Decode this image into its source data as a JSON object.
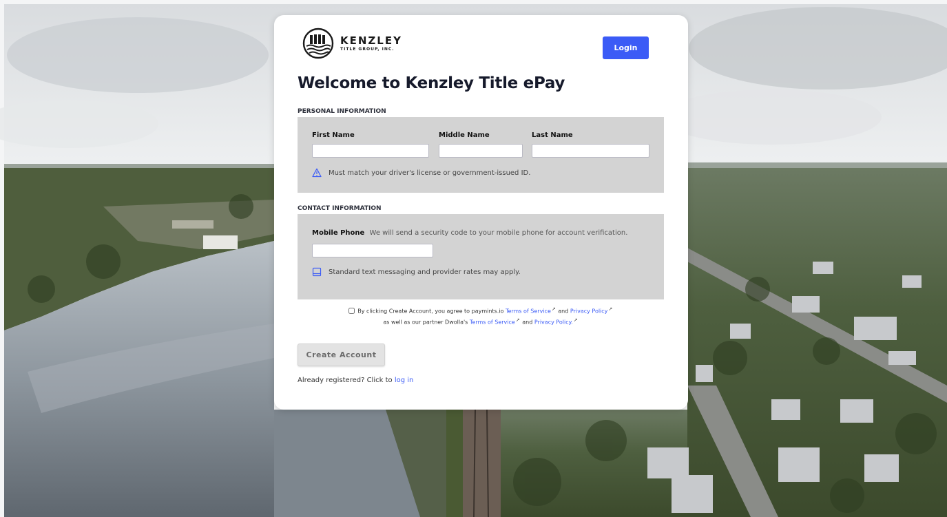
{
  "brand": {
    "name": "KENZLEY",
    "subtitle": "TITLE GROUP, INC."
  },
  "header": {
    "login_label": "Login"
  },
  "page": {
    "title": "Welcome to Kenzley Title ePay"
  },
  "personal": {
    "section_label": "PERSONAL INFORMATION",
    "first_name_label": "First Name",
    "middle_name_label": "Middle Name",
    "last_name_label": "Last Name",
    "first_name_value": "",
    "middle_name_value": "",
    "last_name_value": "",
    "warning_text": "Must match your driver's license or government-issued ID."
  },
  "contact": {
    "section_label": "CONTACT INFORMATION",
    "mobile_label": "Mobile Phone",
    "mobile_hint": "We will send a security code to your mobile phone for account verification.",
    "mobile_value": "",
    "sms_note": "Standard text messaging and provider rates may apply."
  },
  "agreement": {
    "checked": false,
    "text_1": "By clicking Create Account, you agree to paymints.io",
    "tos_link_1": "Terms of Service",
    "and_1": "and",
    "privacy_link_1": "Privacy Policy",
    "text_2": "as well as our partner Dwolla's",
    "tos_link_2": "Terms of Service",
    "and_2": "and",
    "privacy_link_2": "Privacy Policy.",
    "external_icon": "external-link-icon"
  },
  "actions": {
    "create_account_label": "Create Account",
    "already_text": "Already registered? Click to",
    "login_link": "log in"
  },
  "colors": {
    "accent": "#3b5bf6",
    "panel": "#d3d3d3",
    "title": "#161a2b"
  },
  "icons": {
    "logo": "tree-water-logo-icon",
    "warning": "warning-triangle-icon",
    "sms": "mobile-device-icon"
  }
}
